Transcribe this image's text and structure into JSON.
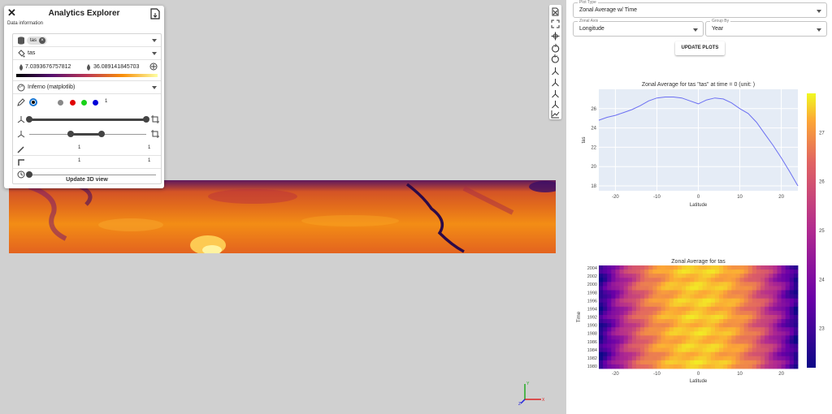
{
  "panel": {
    "title": "Analytics Explorer",
    "section_label": "Data information",
    "dataset_chip": "tas",
    "variable": "tas",
    "range_min": "7.0393676757812",
    "range_max": "36.089141845703",
    "colormap": "Inferno (matplotlib)",
    "opacity_value": "1",
    "scale_value": "1",
    "thickness_left": "1",
    "thickness_right": "1",
    "spacing_left": "1",
    "spacing_right": "1",
    "update_button": "Update 3D view",
    "colors": {
      "accent": "#1976d2",
      "swatch_gray": "#888888",
      "swatch_red": "#e00000",
      "swatch_green": "#19d219",
      "swatch_blue": "#0000d8"
    }
  },
  "right_panel": {
    "plot_type": {
      "label": "Plot Type",
      "value": "Zonal Average w/ Time"
    },
    "zonal_axis": {
      "label": "Zonal Axis",
      "value": "Longitude"
    },
    "group_by": {
      "label": "Group By",
      "value": "Year"
    },
    "update_button": "UPDATE PLOTS"
  },
  "chart_data": [
    {
      "type": "line",
      "title": "Zonal Average for tas \"tas\" at time = 0 (unit: )",
      "xlabel": "Latitude",
      "ylabel": "tas",
      "xlim": [
        -24,
        24
      ],
      "ylim": [
        17.5,
        28
      ],
      "x_ticks": [
        -20,
        -10,
        0,
        10,
        20
      ],
      "y_ticks": [
        18,
        20,
        22,
        24,
        26
      ],
      "line_color": "#6b6ff2",
      "x": [
        -24,
        -22,
        -20,
        -18,
        -16,
        -14,
        -12,
        -10,
        -8,
        -6,
        -4,
        -2,
        0,
        2,
        4,
        6,
        8,
        10,
        12,
        14,
        16,
        18,
        20,
        22,
        24
      ],
      "values": [
        24.8,
        25.1,
        25.3,
        25.6,
        25.9,
        26.3,
        26.8,
        27.1,
        27.2,
        27.2,
        27.1,
        26.8,
        26.5,
        26.9,
        27.1,
        27.0,
        26.6,
        26.0,
        25.5,
        24.6,
        23.4,
        22.2,
        20.9,
        19.5,
        18.0
      ],
      "grid": true
    },
    {
      "type": "heatmap",
      "title": "Zonal Average for tas",
      "xlabel": "Latitude",
      "ylabel": "Time",
      "xlim": [
        -24,
        24
      ],
      "x_ticks": [
        -20,
        -10,
        0,
        10,
        20
      ],
      "y_ticks": [
        1980,
        1982,
        1984,
        1986,
        1988,
        1990,
        1992,
        1994,
        1996,
        1998,
        2000,
        2002,
        2004
      ],
      "colorbar_ticks": [
        23,
        24,
        25,
        26,
        27
      ],
      "colorbar_range": [
        22.2,
        27.8
      ],
      "colorscale": "Plasma"
    }
  ]
}
